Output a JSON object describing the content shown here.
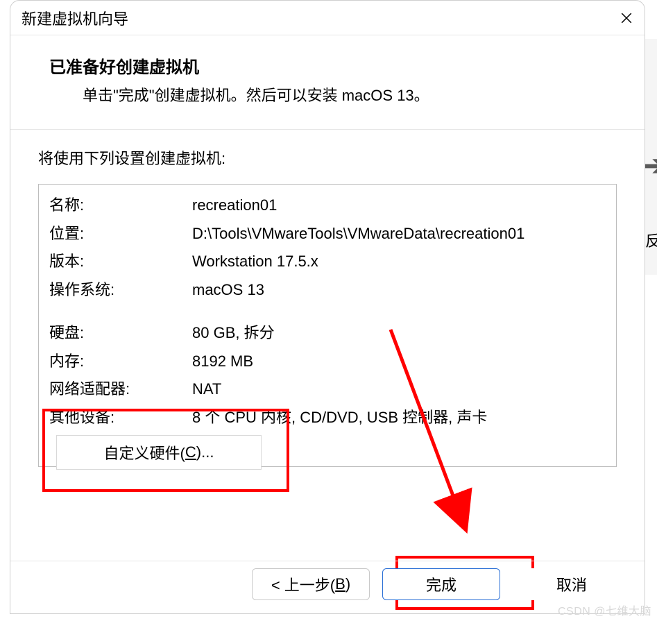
{
  "titlebar": {
    "title": "新建虚拟机向导",
    "close_icon": "close-icon"
  },
  "header": {
    "heading": "已准备好创建虚拟机",
    "sub": "单击\"完成\"创建虚拟机。然后可以安装 macOS 13。"
  },
  "content": {
    "intro": "将使用下列设置创建虚拟机:",
    "summary": {
      "rows_top": [
        {
          "label": "名称:",
          "value": "recreation01"
        },
        {
          "label": "位置:",
          "value": "D:\\Tools\\VMwareTools\\VMwareData\\recreation01"
        },
        {
          "label": "版本:",
          "value": "Workstation 17.5.x"
        },
        {
          "label": "操作系统:",
          "value": "macOS 13"
        }
      ],
      "rows_bottom": [
        {
          "label": "硬盘:",
          "value": "80 GB, 拆分"
        },
        {
          "label": "内存:",
          "value": "8192 MB"
        },
        {
          "label": "网络适配器:",
          "value": "NAT"
        },
        {
          "label": "其他设备:",
          "value": "8 个 CPU 内核, CD/DVD, USB 控制器, 声卡"
        }
      ]
    },
    "customize_btn_pre": "自定义硬件(",
    "customize_btn_key": "C",
    "customize_btn_post": ")..."
  },
  "buttons": {
    "back_pre": "< 上一步(",
    "back_key": "B",
    "back_post": ")",
    "finish": "完成",
    "cancel": "取消"
  },
  "watermark": "CSDN @七维大脑",
  "bg": {
    "arrow": "➔",
    "glyph": "反"
  }
}
